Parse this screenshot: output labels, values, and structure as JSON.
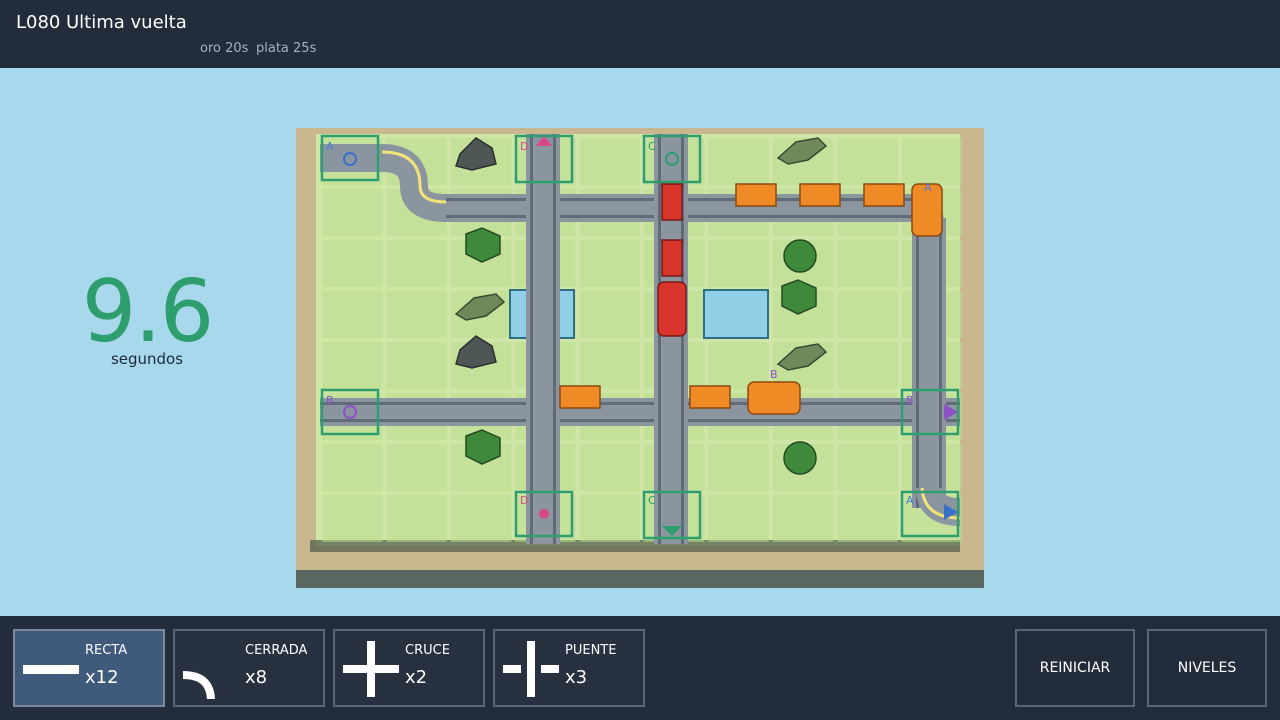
{
  "header": {
    "level_code": "L080",
    "level_name": "Ultima vuelta",
    "medal_gold": "oro 20s",
    "medal_silver": "plata 25s"
  },
  "timer": {
    "value": "9.6",
    "unit": "segundos"
  },
  "board": {
    "station_letters": [
      "A",
      "D",
      "C",
      "B",
      "B",
      "D",
      "C",
      "A"
    ],
    "train_letters": [
      "A",
      "B"
    ],
    "colors": {
      "grass": "#cfe6a6",
      "tile": "#bcdc8f",
      "track": "#8a95a0",
      "rail": "#5f6b76",
      "station": "#2e9e6e",
      "train_red": "#d9342b",
      "train_orange": "#f08a24",
      "water": "#8fd0e6",
      "tree": "#3f8a3a"
    }
  },
  "toolbar": {
    "pieces": [
      {
        "name": "RECTA",
        "count": "x12",
        "icon": "straight-track-icon"
      },
      {
        "name": "CERRADA",
        "count": "x8",
        "icon": "curve-track-icon"
      },
      {
        "name": "CRUCE",
        "count": "x2",
        "icon": "cross-track-icon"
      },
      {
        "name": "PUENTE",
        "count": "x3",
        "icon": "bridge-track-icon"
      }
    ],
    "restart_label": "REINICIAR",
    "levels_label": "NIVELES"
  }
}
